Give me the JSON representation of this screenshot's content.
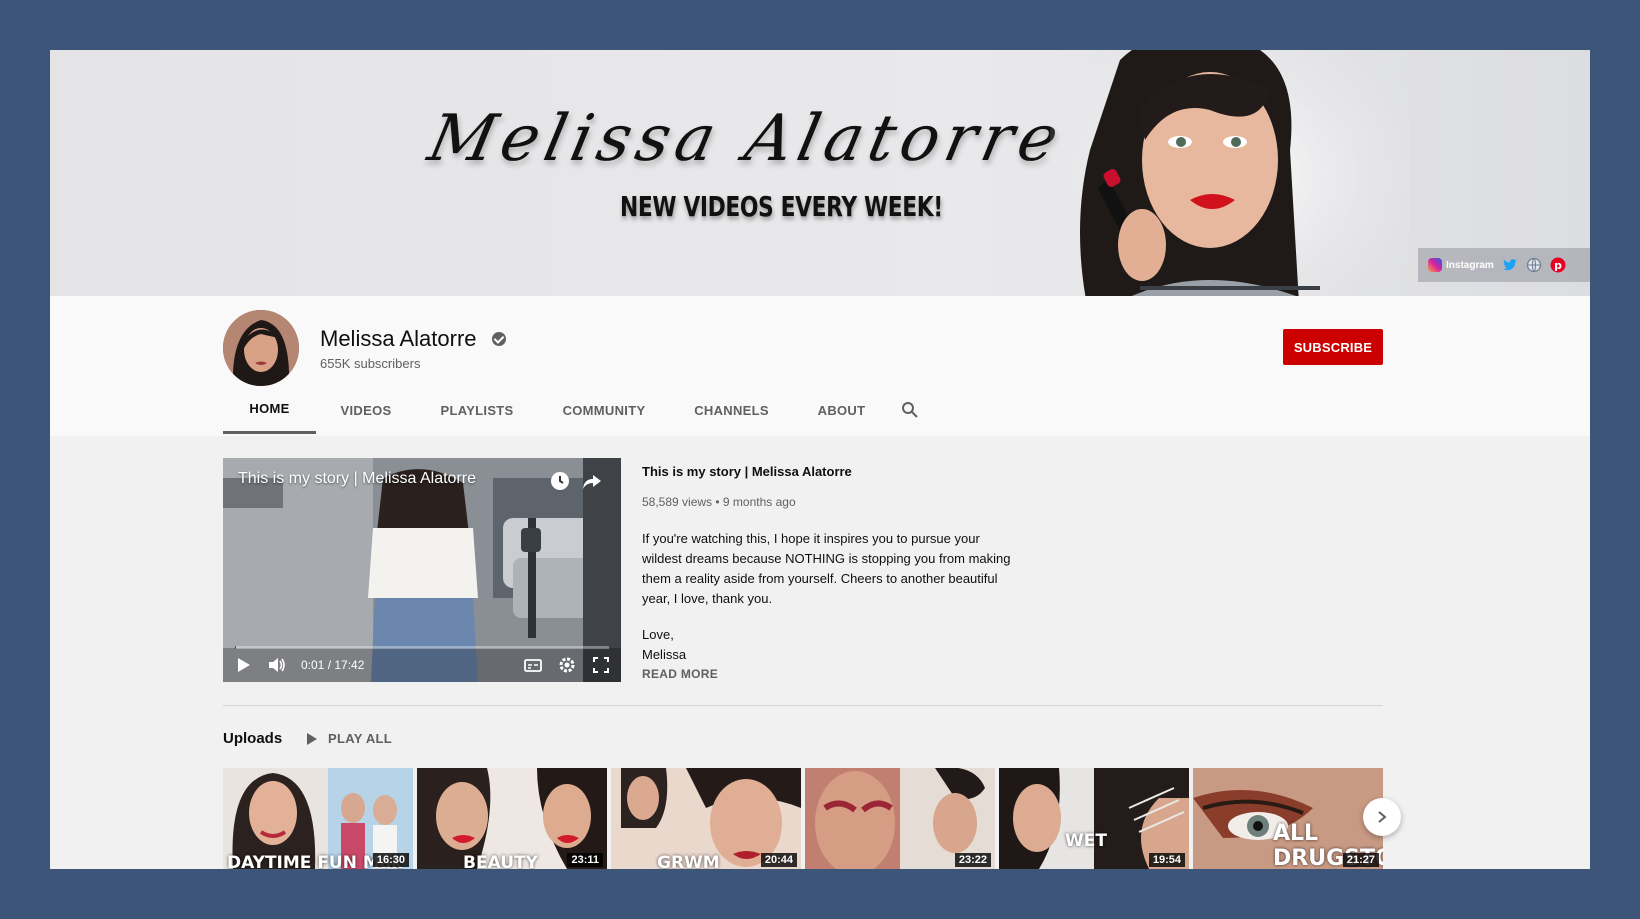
{
  "banner": {
    "script_name": "Melissa Alatorre",
    "tagline": "NEW VIDEOS EVERY WEEK!",
    "social": {
      "instagram_label": "Instagram"
    }
  },
  "channel": {
    "name": "Melissa Alatorre",
    "subscribers": "655K subscribers",
    "subscribe_label": "SUBSCRIBE"
  },
  "tabs": [
    {
      "label": "HOME",
      "active": true
    },
    {
      "label": "VIDEOS"
    },
    {
      "label": "PLAYLISTS"
    },
    {
      "label": "COMMUNITY"
    },
    {
      "label": "CHANNELS"
    },
    {
      "label": "ABOUT"
    }
  ],
  "featured": {
    "player_title": "This is my story | Melissa Alatorre",
    "time": "0:01 / 17:42",
    "progress_fraction": 0.001,
    "title": "This is my story | Melissa Alatorre",
    "meta": "58,589 views • 9 months ago",
    "description": "If you're watching this, I hope it inspires you to pursue your wildest dreams because NOTHING is stopping you from making them a reality aside from yourself. Cheers to another beautiful year, I love, thank you.",
    "signoff": "Love,\nMelissa",
    "read_more": "READ MORE"
  },
  "uploads": {
    "label": "Uploads",
    "play_all": "PLAY ALL",
    "videos": [
      {
        "overlay": "DAYTIME FUN Mak",
        "duration": "16:30"
      },
      {
        "overlay": "BEAUTY",
        "duration": "23:11"
      },
      {
        "overlay": "GRWM",
        "duration": "20:44"
      },
      {
        "overlay": "",
        "duration": "23:22"
      },
      {
        "overlay": "WET",
        "duration": "19:54"
      },
      {
        "overlay": "ALL DRUGSTORE",
        "duration": "21:27"
      }
    ]
  },
  "colors": {
    "accent": "#cc0000",
    "background": "#3d5579"
  }
}
